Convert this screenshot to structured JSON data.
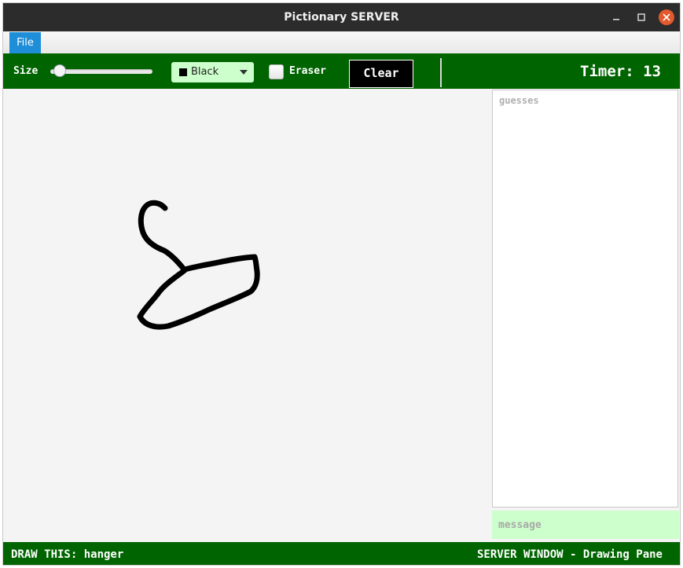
{
  "window": {
    "title": "Pictionary SERVER"
  },
  "menu": {
    "file_label": "File"
  },
  "toolbar": {
    "size_label": "Size",
    "size_value": 0.08,
    "color_selected": "Black",
    "color_swatch": "#000000",
    "eraser_label": "Eraser",
    "eraser_checked": false,
    "clear_label": "Clear",
    "timer_text": "Timer: 13"
  },
  "guesses": {
    "placeholder": "guesses"
  },
  "message": {
    "placeholder": "message"
  },
  "status": {
    "left": "DRAW THIS: hanger",
    "right": "SERVER WINDOW - Drawing Pane"
  },
  "colors": {
    "accent_green": "#006400",
    "light_green": "#ccffcc",
    "menu_active": "#1e8ed8",
    "close_button": "#e25a2e"
  },
  "icons": [
    "minimize-icon",
    "maximize-icon",
    "close-icon",
    "dropdown-arrow-icon"
  ]
}
